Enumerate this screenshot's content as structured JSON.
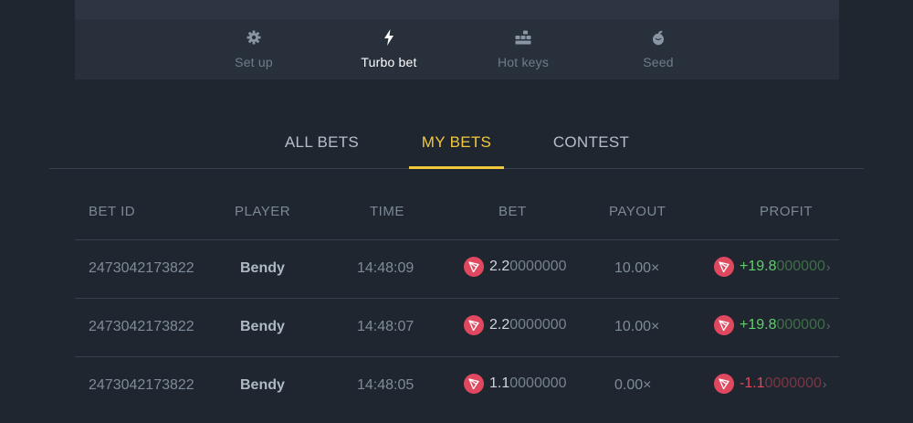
{
  "toolbar": {
    "items": [
      {
        "label": "Set up",
        "icon": "gear-icon",
        "active": false
      },
      {
        "label": "Turbo bet",
        "icon": "lightning-icon",
        "active": true
      },
      {
        "label": "Hot keys",
        "icon": "keyboard-icon",
        "active": false
      },
      {
        "label": "Seed",
        "icon": "seed-icon",
        "active": false
      }
    ]
  },
  "tabs": {
    "items": [
      {
        "label": "ALL BETS",
        "active": false
      },
      {
        "label": "MY BETS",
        "active": true
      },
      {
        "label": "CONTEST",
        "active": false
      }
    ]
  },
  "table": {
    "headers": {
      "bet_id": "BET ID",
      "player": "PLAYER",
      "time": "TIME",
      "bet": "BET",
      "payout": "PAYOUT",
      "profit": "PROFIT"
    },
    "rows": [
      {
        "bet_id": "2473042173822",
        "player": "Bendy",
        "time": "14:48:09",
        "bet_main": "2.2",
        "bet_rest": "0000000",
        "payout": "10.00×",
        "profit_main": "+19.8",
        "profit_rest": "000000",
        "profit_sign": "positive"
      },
      {
        "bet_id": "2473042173822",
        "player": "Bendy",
        "time": "14:48:07",
        "bet_main": "2.2",
        "bet_rest": "0000000",
        "payout": "10.00×",
        "profit_main": "+19.8",
        "profit_rest": "000000",
        "profit_sign": "positive"
      },
      {
        "bet_id": "2473042173822",
        "player": "Bendy",
        "time": "14:48:05",
        "bet_main": "1.1",
        "bet_rest": "0000000",
        "payout": "0.00×",
        "profit_main": "-1.1",
        "profit_rest": "0000000",
        "profit_sign": "negative"
      }
    ]
  },
  "colors": {
    "accent": "#f1c93a",
    "coin": "#e0485f",
    "positive": "#5fcf6a",
    "negative": "#e8455b"
  }
}
